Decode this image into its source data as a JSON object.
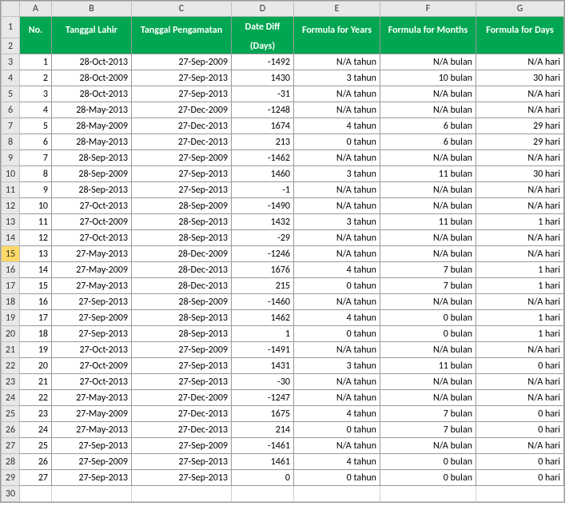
{
  "columns": [
    "A",
    "B",
    "C",
    "D",
    "E",
    "F",
    "G"
  ],
  "header": {
    "A": "No.",
    "B": "Tanggal Lahir",
    "C": "Tanggal Pengamatan",
    "D_line1": "Date Diff",
    "D_line2": "(Days)",
    "E": "Formula for Years",
    "F": "Formula for Months",
    "G": "Formula for Days"
  },
  "selectedRow": 15,
  "emptyRow": 30,
  "rows": [
    {
      "r": 3,
      "no": "1",
      "tl": "28-Oct-2013",
      "tp": "27-Sep-2009",
      "diff": "-1492",
      "y": "N/A tahun",
      "m": "N/A bulan",
      "d": "N/A hari"
    },
    {
      "r": 4,
      "no": "2",
      "tl": "28-Oct-2009",
      "tp": "27-Sep-2013",
      "diff": "1430",
      "y": "3 tahun",
      "m": "10 bulan",
      "d": "30 hari"
    },
    {
      "r": 5,
      "no": "3",
      "tl": "28-Oct-2013",
      "tp": "27-Sep-2013",
      "diff": "-31",
      "y": "N/A tahun",
      "m": "N/A bulan",
      "d": "N/A hari"
    },
    {
      "r": 6,
      "no": "4",
      "tl": "28-May-2013",
      "tp": "27-Dec-2009",
      "diff": "-1248",
      "y": "N/A tahun",
      "m": "N/A bulan",
      "d": "N/A hari"
    },
    {
      "r": 7,
      "no": "5",
      "tl": "28-May-2009",
      "tp": "27-Dec-2013",
      "diff": "1674",
      "y": "4 tahun",
      "m": "6 bulan",
      "d": "29 hari"
    },
    {
      "r": 8,
      "no": "6",
      "tl": "28-May-2013",
      "tp": "27-Dec-2013",
      "diff": "213",
      "y": "0 tahun",
      "m": "6 bulan",
      "d": "29 hari"
    },
    {
      "r": 9,
      "no": "7",
      "tl": "28-Sep-2013",
      "tp": "27-Sep-2009",
      "diff": "-1462",
      "y": "N/A tahun",
      "m": "N/A bulan",
      "d": "N/A hari"
    },
    {
      "r": 10,
      "no": "8",
      "tl": "28-Sep-2009",
      "tp": "27-Sep-2013",
      "diff": "1460",
      "y": "3 tahun",
      "m": "11 bulan",
      "d": "30 hari"
    },
    {
      "r": 11,
      "no": "9",
      "tl": "28-Sep-2013",
      "tp": "27-Sep-2013",
      "diff": "-1",
      "y": "N/A tahun",
      "m": "N/A bulan",
      "d": "N/A hari"
    },
    {
      "r": 12,
      "no": "10",
      "tl": "27-Oct-2013",
      "tp": "28-Sep-2009",
      "diff": "-1490",
      "y": "N/A tahun",
      "m": "N/A bulan",
      "d": "N/A hari"
    },
    {
      "r": 13,
      "no": "11",
      "tl": "27-Oct-2009",
      "tp": "28-Sep-2013",
      "diff": "1432",
      "y": "3 tahun",
      "m": "11 bulan",
      "d": "1 hari"
    },
    {
      "r": 14,
      "no": "12",
      "tl": "27-Oct-2013",
      "tp": "28-Sep-2013",
      "diff": "-29",
      "y": "N/A tahun",
      "m": "N/A bulan",
      "d": "N/A hari"
    },
    {
      "r": 15,
      "no": "13",
      "tl": "27-May-2013",
      "tp": "28-Dec-2009",
      "diff": "-1246",
      "y": "N/A tahun",
      "m": "N/A bulan",
      "d": "N/A hari"
    },
    {
      "r": 16,
      "no": "14",
      "tl": "27-May-2009",
      "tp": "28-Dec-2013",
      "diff": "1676",
      "y": "4 tahun",
      "m": "7 bulan",
      "d": "1 hari"
    },
    {
      "r": 17,
      "no": "15",
      "tl": "27-May-2013",
      "tp": "28-Dec-2013",
      "diff": "215",
      "y": "0 tahun",
      "m": "7 bulan",
      "d": "1 hari"
    },
    {
      "r": 18,
      "no": "16",
      "tl": "27-Sep-2013",
      "tp": "28-Sep-2009",
      "diff": "-1460",
      "y": "N/A tahun",
      "m": "N/A bulan",
      "d": "N/A hari"
    },
    {
      "r": 19,
      "no": "17",
      "tl": "27-Sep-2009",
      "tp": "28-Sep-2013",
      "diff": "1462",
      "y": "4 tahun",
      "m": "0 bulan",
      "d": "1 hari"
    },
    {
      "r": 20,
      "no": "18",
      "tl": "27-Sep-2013",
      "tp": "28-Sep-2013",
      "diff": "1",
      "y": "0 tahun",
      "m": "0 bulan",
      "d": "1 hari"
    },
    {
      "r": 21,
      "no": "19",
      "tl": "27-Oct-2013",
      "tp": "27-Sep-2009",
      "diff": "-1491",
      "y": "N/A tahun",
      "m": "N/A bulan",
      "d": "N/A hari"
    },
    {
      "r": 22,
      "no": "20",
      "tl": "27-Oct-2009",
      "tp": "27-Sep-2013",
      "diff": "1431",
      "y": "3 tahun",
      "m": "11 bulan",
      "d": "0 hari"
    },
    {
      "r": 23,
      "no": "21",
      "tl": "27-Oct-2013",
      "tp": "27-Sep-2013",
      "diff": "-30",
      "y": "N/A tahun",
      "m": "N/A bulan",
      "d": "N/A hari"
    },
    {
      "r": 24,
      "no": "22",
      "tl": "27-May-2013",
      "tp": "27-Dec-2009",
      "diff": "-1247",
      "y": "N/A tahun",
      "m": "N/A bulan",
      "d": "N/A hari"
    },
    {
      "r": 25,
      "no": "23",
      "tl": "27-May-2009",
      "tp": "27-Dec-2013",
      "diff": "1675",
      "y": "4 tahun",
      "m": "7 bulan",
      "d": "0 hari"
    },
    {
      "r": 26,
      "no": "24",
      "tl": "27-May-2013",
      "tp": "27-Dec-2013",
      "diff": "214",
      "y": "0 tahun",
      "m": "7 bulan",
      "d": "0 hari"
    },
    {
      "r": 27,
      "no": "25",
      "tl": "27-Sep-2013",
      "tp": "27-Sep-2009",
      "diff": "-1461",
      "y": "N/A tahun",
      "m": "N/A bulan",
      "d": "N/A hari"
    },
    {
      "r": 28,
      "no": "26",
      "tl": "27-Sep-2009",
      "tp": "27-Sep-2013",
      "diff": "1461",
      "y": "4 tahun",
      "m": "0 bulan",
      "d": "0 hari"
    },
    {
      "r": 29,
      "no": "27",
      "tl": "27-Sep-2013",
      "tp": "27-Sep-2013",
      "diff": "0",
      "y": "0 tahun",
      "m": "0 bulan",
      "d": "0 hari"
    }
  ]
}
